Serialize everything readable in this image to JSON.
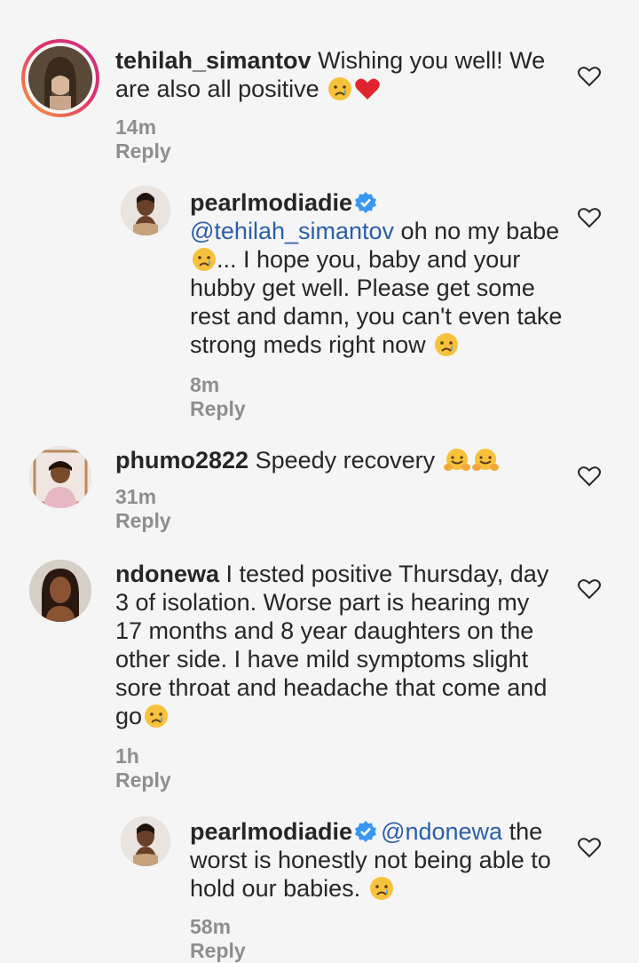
{
  "comments": [
    {
      "username": "tehilah_simantov",
      "body": "Wishing you well! We are also all positive",
      "time": "14m",
      "reply_label": "Reply"
    },
    {
      "username": "pearlmodiadie",
      "mention": "@tehilah_simantov",
      "body": "oh no my babe",
      "body2": "... I hope you, baby and your hubby get well. Please get some rest and damn, you can't even take strong meds right now",
      "time": "8m",
      "reply_label": "Reply"
    },
    {
      "username": "phumo2822",
      "body": "Speedy recovery",
      "time": "31m",
      "reply_label": "Reply"
    },
    {
      "username": "ndonewa",
      "body": "I tested positive Thursday, day 3 of isolation. Worse part is hearing my 17 months and 8 year daughters on the other side. I have mild symptoms slight sore throat and headache that come and go",
      "time": "1h",
      "reply_label": "Reply"
    },
    {
      "username": "pearlmodiadie",
      "mention": "@ndonewa",
      "body": "the worst is honestly not being able to hold our babies.",
      "time": "58m",
      "reply_label": "Reply"
    }
  ],
  "colors": {
    "background": "#f5f5f5",
    "text": "#262626",
    "meta": "#8e8e8e",
    "mention": "#2a5fa8",
    "verified": "#3897f0",
    "heart": "#262626"
  },
  "icons": [
    "heart-outline-icon",
    "verified-badge-icon",
    "crying-face-emoji",
    "red-heart-emoji",
    "hugging-face-emoji"
  ]
}
